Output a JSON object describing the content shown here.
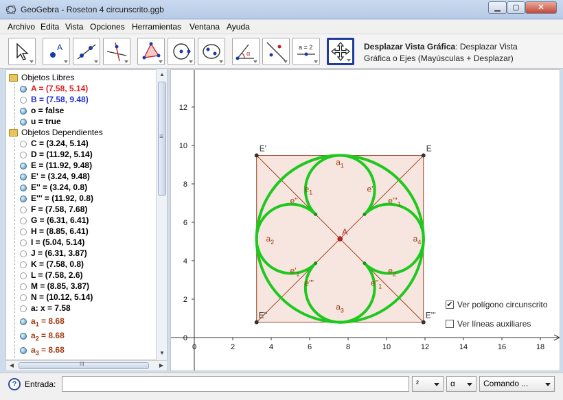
{
  "window": {
    "title": "GeoGebra - Roseton 4 circunscrito.ggb"
  },
  "menu": [
    "Archivo",
    "Edita",
    "Vista",
    "Opciones",
    "Herramientas",
    "Ventana",
    "Ayuda"
  ],
  "toolbar": {
    "help_title": "Desplazar Vista Gráfica",
    "help_text": ": Desplazar Vista Gráfica o Ejes (Mayúsculas + Desplazar)",
    "slider_tool_label": "a = 2",
    "tools": [
      "move",
      "point",
      "line",
      "perpendicular",
      "polygon",
      "circle",
      "conic",
      "angle",
      "reflect",
      "slider",
      "move-graphics-view"
    ]
  },
  "algebra": {
    "free_folder": "Objetos Libres",
    "free": [
      {
        "text": "A = (7.58, 5.14)",
        "color": "#e02020",
        "shown": true
      },
      {
        "text": "B = (7.58, 9.48)",
        "color": "#2030d0",
        "shown": false
      },
      {
        "text": "o = false",
        "color": "#000000",
        "shown": true
      },
      {
        "text": "u = true",
        "color": "#000000",
        "shown": true
      }
    ],
    "dependent_folder": "Objetos Dependientes",
    "dependent": [
      {
        "text": "C = (3.24, 5.14)",
        "color": "#000000",
        "shown": false
      },
      {
        "text": "D = (11.92, 5.14)",
        "color": "#000000",
        "shown": false
      },
      {
        "text": "E = (11.92, 9.48)",
        "color": "#000000",
        "shown": true
      },
      {
        "text": "E' = (3.24, 9.48)",
        "color": "#000000",
        "shown": true
      },
      {
        "text": "E'' = (3.24, 0.8)",
        "color": "#000000",
        "shown": true
      },
      {
        "text": "E''' = (11.92, 0.8)",
        "color": "#000000",
        "shown": true
      },
      {
        "text": "F = (7.58, 7.68)",
        "color": "#000000",
        "shown": false
      },
      {
        "text": "G = (6.31, 6.41)",
        "color": "#000000",
        "shown": false
      },
      {
        "text": "H = (8.85, 6.41)",
        "color": "#000000",
        "shown": false
      },
      {
        "text": "I = (5.04, 5.14)",
        "color": "#000000",
        "shown": false
      },
      {
        "text": "J = (6.31, 3.87)",
        "color": "#000000",
        "shown": false
      },
      {
        "text": "K = (7.58, 0.8)",
        "color": "#000000",
        "shown": false
      },
      {
        "text": "L = (7.58, 2.6)",
        "color": "#000000",
        "shown": false
      },
      {
        "text": "M = (8.85, 3.87)",
        "color": "#000000",
        "shown": false
      },
      {
        "text": "N = (10.12, 5.14)",
        "color": "#000000",
        "shown": false
      },
      {
        "text": "a: x = 7.58",
        "color": "#000000",
        "shown": false
      }
    ],
    "arcs": [
      {
        "name": "a",
        "sub": "1",
        "value": "= 8.68",
        "color": "#a03a10"
      },
      {
        "name": "a",
        "sub": "2",
        "value": "= 8.68",
        "color": "#a03a10"
      },
      {
        "name": "a",
        "sub": "3",
        "value": "= 8.68",
        "color": "#a03a10"
      }
    ],
    "scroll_grip": "≡",
    "hscroll_grip": "III"
  },
  "graphics": {
    "x_ticks": [
      "0",
      "2",
      "4",
      "6",
      "8",
      "10",
      "12",
      "14",
      "16",
      "18"
    ],
    "y_ticks": [
      "0",
      "2",
      "4",
      "6",
      "8",
      "10",
      "12"
    ],
    "square_corners": {
      "E": [
        11.92,
        9.48
      ],
      "E'": [
        3.24,
        9.48
      ],
      "E''": [
        3.24,
        0.8
      ],
      "E'''": [
        11.92,
        0.8
      ]
    },
    "center": {
      "label": "A",
      "x": 7.58,
      "y": 5.14
    },
    "colors": {
      "square_fill": "#f6e6df",
      "square_stroke": "#a04020",
      "green": "#1ec81e",
      "label": "#a03a10",
      "point": "#c02020"
    },
    "labels": {
      "E": "E",
      "Ep": "E'",
      "Epp": "E''",
      "Eppp": "E'''",
      "A": "A",
      "a1": "a",
      "a1s": "1",
      "a2": "a",
      "a2s": "2",
      "a3": "a",
      "a3s": "3",
      "a4": "a",
      "a4s": "4",
      "e1": "e",
      "e1s": "1",
      "e2": "e",
      "e2s": "2",
      "ep": "e'",
      "epp": "e''",
      "eppp": "e'''",
      "ep1": "e'",
      "ep1s": "1",
      "epp1": "e''",
      "epp1s": "1",
      "eppp1": "e'''",
      "eppp1s": "1"
    },
    "checkboxes": [
      {
        "label": "Ver polígono circunscrito",
        "checked": true
      },
      {
        "label": "Ver líneas auxiliares",
        "checked": false
      }
    ]
  },
  "inputbar": {
    "label": "Entrada:",
    "value": "",
    "dropdowns": [
      "²",
      "α",
      "Comando ..."
    ]
  }
}
